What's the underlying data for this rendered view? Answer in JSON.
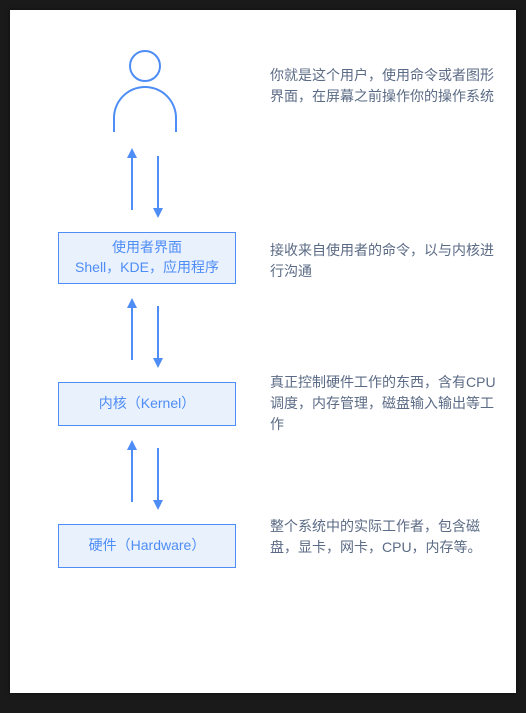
{
  "colors": {
    "stroke": "#4e8df5",
    "fill": "#e9f1fd",
    "text_node": "#4e8df5",
    "text_desc": "#5b6b85",
    "page_bg": "#ffffff"
  },
  "nodes": {
    "user": {
      "kind": "icon",
      "icon_name": "user-icon"
    },
    "shell": {
      "line1": "使用者界面",
      "line2": "Shell，KDE，应用程序"
    },
    "kernel": {
      "label": "内核（Kernel）"
    },
    "hardware": {
      "label": "硬件（Hardware）"
    }
  },
  "descriptions": {
    "user": "你就是这个用户，使用命令或者图形界面，在屏幕之前操作你的操作系统",
    "shell": "接收来自使用者的命令，以与内核进行沟通",
    "kernel": "真正控制硬件工作的东西，含有CPU调度，内存管理，磁盘输入输出等工作",
    "hardware": "整个系统中的实际工作者，包含磁盘，显卡，网卡，CPU，内存等。"
  },
  "edges": [
    {
      "from": "user",
      "to": "shell",
      "bidirectional": true
    },
    {
      "from": "shell",
      "to": "kernel",
      "bidirectional": true
    },
    {
      "from": "kernel",
      "to": "hardware",
      "bidirectional": true
    }
  ]
}
